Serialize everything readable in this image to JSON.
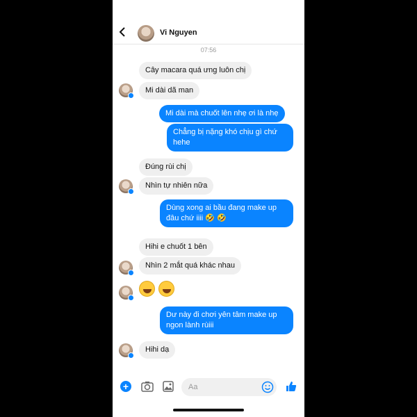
{
  "header": {
    "contact_name": "Vi Nguyen",
    "back_icon": "chevron-left-icon"
  },
  "time": "07:56",
  "messages": [
    {
      "dir": "in",
      "text": "Cây macara quá ưng luôn chị"
    },
    {
      "dir": "in",
      "text": "Mi dài dã man"
    },
    {
      "dir": "out",
      "text": "Mi dài mà chuốt lên nhẹ ơi là nhẹ"
    },
    {
      "dir": "out",
      "text": "Chẳng bị nặng khó chịu gì chứ",
      "text2": "hehe"
    },
    {
      "dir": "in",
      "text": "Đúng rùi chị"
    },
    {
      "dir": "in",
      "text": "Nhìn tự nhiên nữa"
    },
    {
      "dir": "out",
      "text": "Dùng xong ai bầu đang make up",
      "text2": "đâu chứ iiii 🤣 🤣"
    },
    {
      "dir": "in",
      "text": "Hihi e chuốt 1 bên"
    },
    {
      "dir": "in",
      "text": "Nhìn 2 mắt quá khác nhau"
    },
    {
      "dir": "in",
      "emoji": "🤣🤣"
    },
    {
      "dir": "out",
      "text": "Dư này đi chơi yên tâm  make up",
      "text2": "ngon lành rùiii"
    },
    {
      "dir": "in",
      "text": "Hihi dạ"
    }
  ],
  "composer": {
    "placeholder": "Aa",
    "icons": [
      "plus-icon",
      "camera-icon",
      "gallery-icon",
      "emoji-icon",
      "like-icon"
    ]
  },
  "colors": {
    "accent": "#0a84ff",
    "incoming_bubble": "#efefef"
  }
}
